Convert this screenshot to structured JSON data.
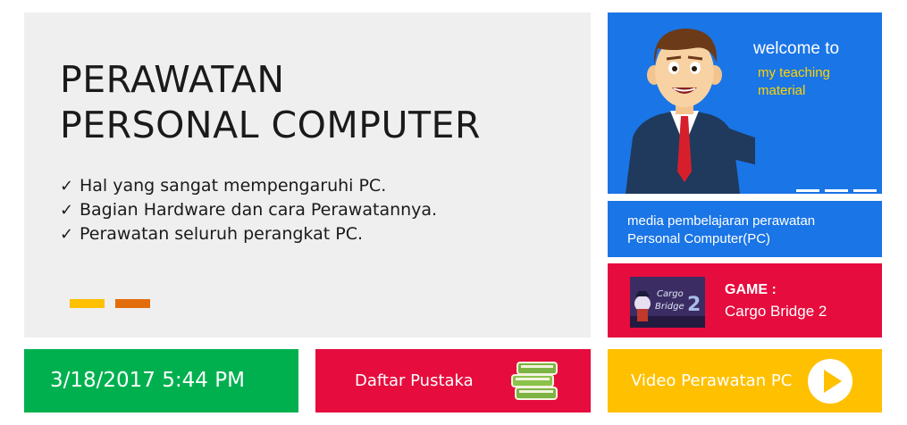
{
  "main": {
    "title_line1": "PERAWATAN",
    "title_line2": "PERSONAL COMPUTER",
    "check_glyph": "✓",
    "points": [
      "Hal yang sangat mempengaruhi PC.",
      "Bagian Hardware dan cara Perawatannya.",
      "Perawatan seluruh perangkat PC."
    ]
  },
  "welcome": {
    "line1": "welcome to",
    "line2": "my teaching material",
    "illustration": "teacher-presenting-illustration",
    "slides_count": 3
  },
  "media": {
    "line1": "media pembelajaran perawatan",
    "line2": "Personal Computer(PC)"
  },
  "game": {
    "label": "GAME :",
    "name": "Cargo Bridge 2",
    "thumb_title_1": "Cargo",
    "thumb_title_2": "Bridge",
    "thumb_number": "2"
  },
  "clock": {
    "datetime": "3/18/2017 5:44 PM"
  },
  "pustaka": {
    "label": "Daftar Pustaka",
    "icon": "books-icon"
  },
  "video": {
    "label": "Video Perawatan PC",
    "icon": "play-icon"
  },
  "colors": {
    "blue": "#1a75e6",
    "red": "#e60c3e",
    "green": "#00b04f",
    "yellow": "#ffc000",
    "orange": "#e36c0a",
    "grey": "#efefef"
  }
}
